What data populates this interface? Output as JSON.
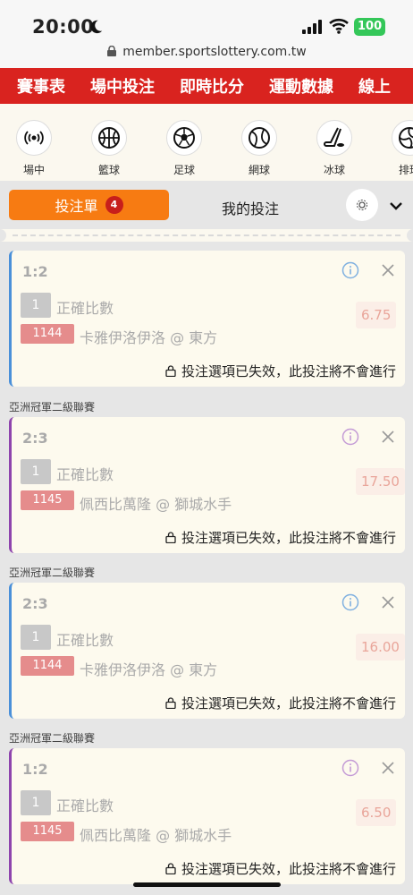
{
  "status": {
    "time": "20:00",
    "battery": "100",
    "url": "member.sportslottery.com.tw"
  },
  "nav": {
    "items": [
      "賽事表",
      "場中投注",
      "即時比分",
      "運動數據",
      "線上"
    ]
  },
  "sports": [
    {
      "label": "場中",
      "icon": "live-icon"
    },
    {
      "label": "籃球",
      "icon": "basketball-icon"
    },
    {
      "label": "足球",
      "icon": "soccer-icon"
    },
    {
      "label": "網球",
      "icon": "tennis-icon"
    },
    {
      "label": "冰球",
      "icon": "hockey-icon"
    },
    {
      "label": "排球",
      "icon": "volleyball-icon"
    }
  ],
  "tabs": {
    "betslip": "投注單",
    "betslip_count": "4",
    "mybets": "我的投注"
  },
  "league_name": "亞洲冠軍二級聯賽",
  "bets": [
    {
      "score": "1:2",
      "num": "1",
      "market": "正確比數",
      "code": "1144",
      "match": "卡雅伊洛伊洛 @ 東方",
      "odds": "6.75",
      "notice": "投注選項已失效，此投注將不會進行"
    },
    {
      "score": "2:3",
      "num": "1",
      "market": "正確比數",
      "code": "1145",
      "match": "佩西比萬隆 @ 獅城水手",
      "odds": "17.50",
      "notice": "投注選項已失效，此投注將不會進行"
    },
    {
      "score": "2:3",
      "num": "1",
      "market": "正確比數",
      "code": "1144",
      "match": "卡雅伊洛伊洛 @ 東方",
      "odds": "16.00",
      "notice": "投注選項已失效，此投注將不會進行"
    },
    {
      "score": "1:2",
      "num": "1",
      "market": "正確比數",
      "code": "1145",
      "match": "佩西比萬隆 @ 獅城水手",
      "odds": "6.50",
      "notice": "投注選項已失效，此投注將不會進行"
    }
  ],
  "colors": {
    "brand_red": "#d9231f",
    "tab_orange": "#f77b12",
    "card_bg": "#fdfaee"
  }
}
